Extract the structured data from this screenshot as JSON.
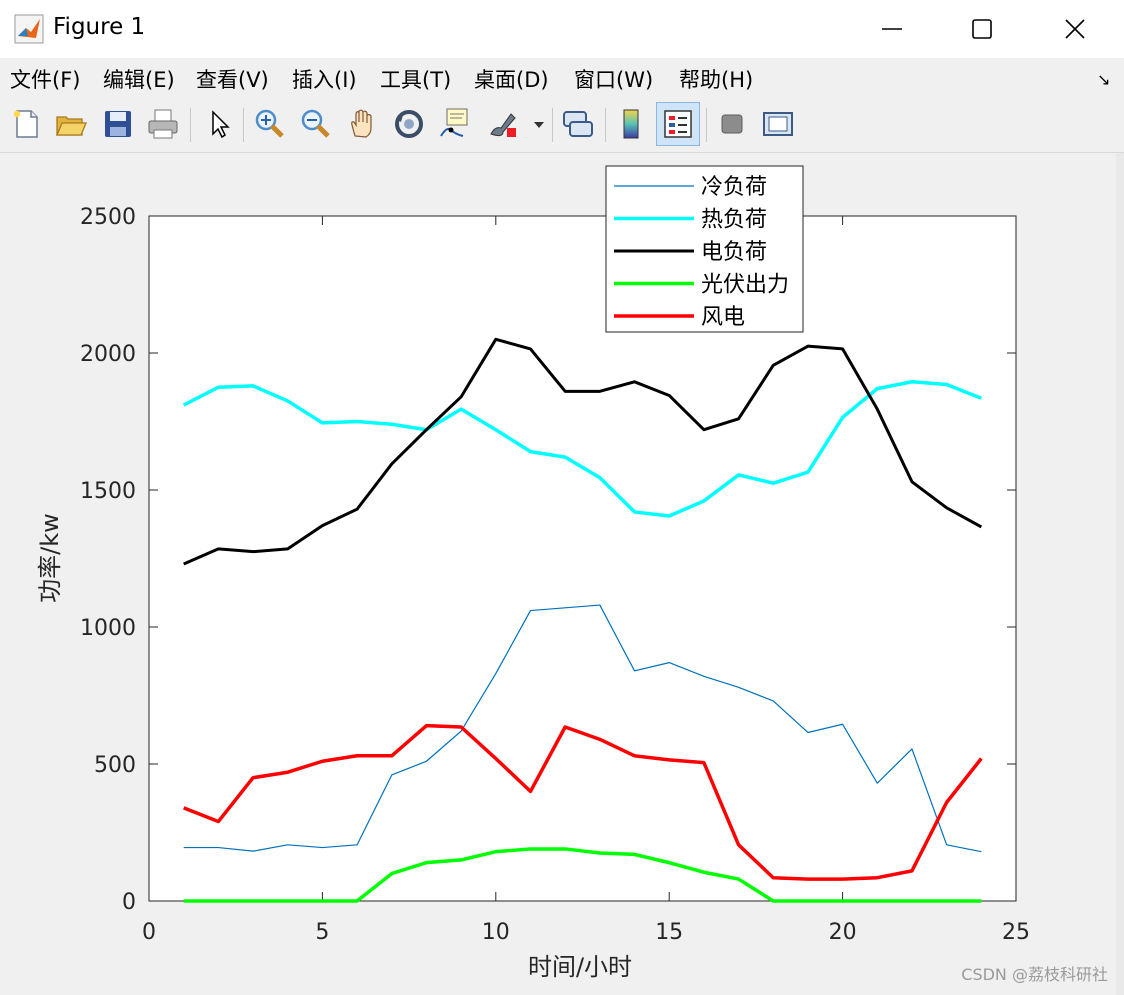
{
  "window": {
    "title": "Figure 1"
  },
  "menu": [
    "文件(F)",
    "编辑(E)",
    "查看(V)",
    "插入(I)",
    "工具(T)",
    "桌面(D)",
    "窗口(W)",
    "帮助(H)"
  ],
  "toolbar": {
    "icons": [
      "new-figure-icon",
      "open-file-icon",
      "save-icon",
      "print-icon",
      "pointer-icon",
      "zoom-in-icon",
      "zoom-out-icon",
      "pan-icon",
      "rotate-3d-icon",
      "data-cursor-icon",
      "brush-icon",
      "link-plot-icon",
      "colorbar-icon",
      "legend-icon",
      "hide-plot-tools-icon",
      "show-plot-tools-icon"
    ]
  },
  "watermark": "CSDN @荔枝科研社",
  "chart_data": {
    "type": "line",
    "xlabel": "时间/小时",
    "ylabel": "功率/kw",
    "xlim": [
      0,
      25
    ],
    "ylim": [
      0,
      2500
    ],
    "xticks": [
      0,
      5,
      10,
      15,
      20,
      25
    ],
    "yticks": [
      0,
      500,
      1000,
      1500,
      2000,
      2500
    ],
    "grid": false,
    "legend_position": "top-center",
    "x": [
      1,
      2,
      3,
      4,
      5,
      6,
      7,
      8,
      9,
      10,
      11,
      12,
      13,
      14,
      15,
      16,
      17,
      18,
      19,
      20,
      21,
      22,
      23,
      24
    ],
    "series": [
      {
        "name": "冷负荷",
        "color": "#0072bd",
        "width": 1.2,
        "values": [
          195,
          195,
          182,
          205,
          195,
          205,
          460,
          510,
          620,
          830,
          1060,
          1070,
          1080,
          840,
          870,
          820,
          780,
          730,
          615,
          645,
          430,
          555,
          205,
          180
        ]
      },
      {
        "name": "热负荷",
        "color": "#00ffff",
        "width": 3.5,
        "values": [
          1810,
          1875,
          1880,
          1825,
          1745,
          1750,
          1740,
          1720,
          1795,
          1720,
          1640,
          1620,
          1545,
          1420,
          1405,
          1460,
          1555,
          1525,
          1565,
          1765,
          1870,
          1895,
          1885,
          1835
        ]
      },
      {
        "name": "电负荷",
        "color": "#000000",
        "width": 3,
        "values": [
          1230,
          1285,
          1275,
          1285,
          1370,
          1430,
          1595,
          1720,
          1840,
          2050,
          2015,
          1860,
          1860,
          1895,
          1845,
          1720,
          1760,
          1955,
          2025,
          2015,
          1795,
          1530,
          1435,
          1365
        ]
      },
      {
        "name": "光伏出力",
        "color": "#00ff00",
        "width": 3.5,
        "values": [
          0,
          0,
          0,
          0,
          0,
          0,
          100,
          140,
          150,
          180,
          190,
          190,
          175,
          170,
          140,
          105,
          80,
          0,
          0,
          0,
          0,
          0,
          0,
          0
        ]
      },
      {
        "name": "风电",
        "color": "#ff0000",
        "width": 3.5,
        "values": [
          340,
          290,
          450,
          470,
          510,
          530,
          530,
          640,
          635,
          520,
          400,
          635,
          590,
          530,
          515,
          505,
          205,
          85,
          80,
          80,
          85,
          110,
          360,
          520
        ]
      }
    ]
  }
}
